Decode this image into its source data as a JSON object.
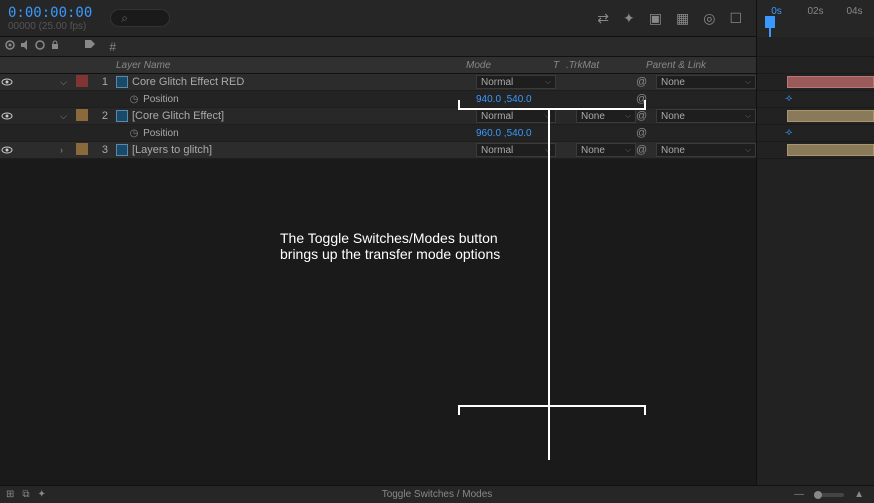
{
  "timecode": {
    "main": "0:00:00:00",
    "sub": "00000 (25.00 fps)"
  },
  "search": {
    "placeholder": "⌕"
  },
  "ruler": {
    "marks": [
      "0s",
      "02s",
      "04s"
    ]
  },
  "columns": {
    "hash": "#",
    "layer_name": "Layer Name",
    "mode": "Mode",
    "t": "T",
    "trkmat": ".TrkMat",
    "parent": "Parent & Link"
  },
  "layers": [
    {
      "index": "1",
      "name": "Core Glitch Effect RED",
      "mode": "Normal",
      "trkmat": "",
      "parent": "None",
      "chip_class": "chip-red",
      "expanded": true,
      "prop": {
        "name": "Position",
        "value": "940.0 ,540.0"
      }
    },
    {
      "index": "2",
      "name": "[Core Glitch Effect]",
      "mode": "Normal",
      "trkmat": "None",
      "parent": "None",
      "chip_class": "chip-gold",
      "expanded": true,
      "prop": {
        "name": "Position",
        "value": "960.0 ,540.0"
      }
    },
    {
      "index": "3",
      "name": "[Layers to glitch]",
      "mode": "Normal",
      "trkmat": "None",
      "parent": "None",
      "chip_class": "chip-gold",
      "expanded": false
    }
  ],
  "annotation": {
    "line1": "The Toggle Switches/Modes button",
    "line2": "brings up the transfer mode options"
  },
  "bottom": {
    "toggle": "Toggle Switches / Modes"
  }
}
